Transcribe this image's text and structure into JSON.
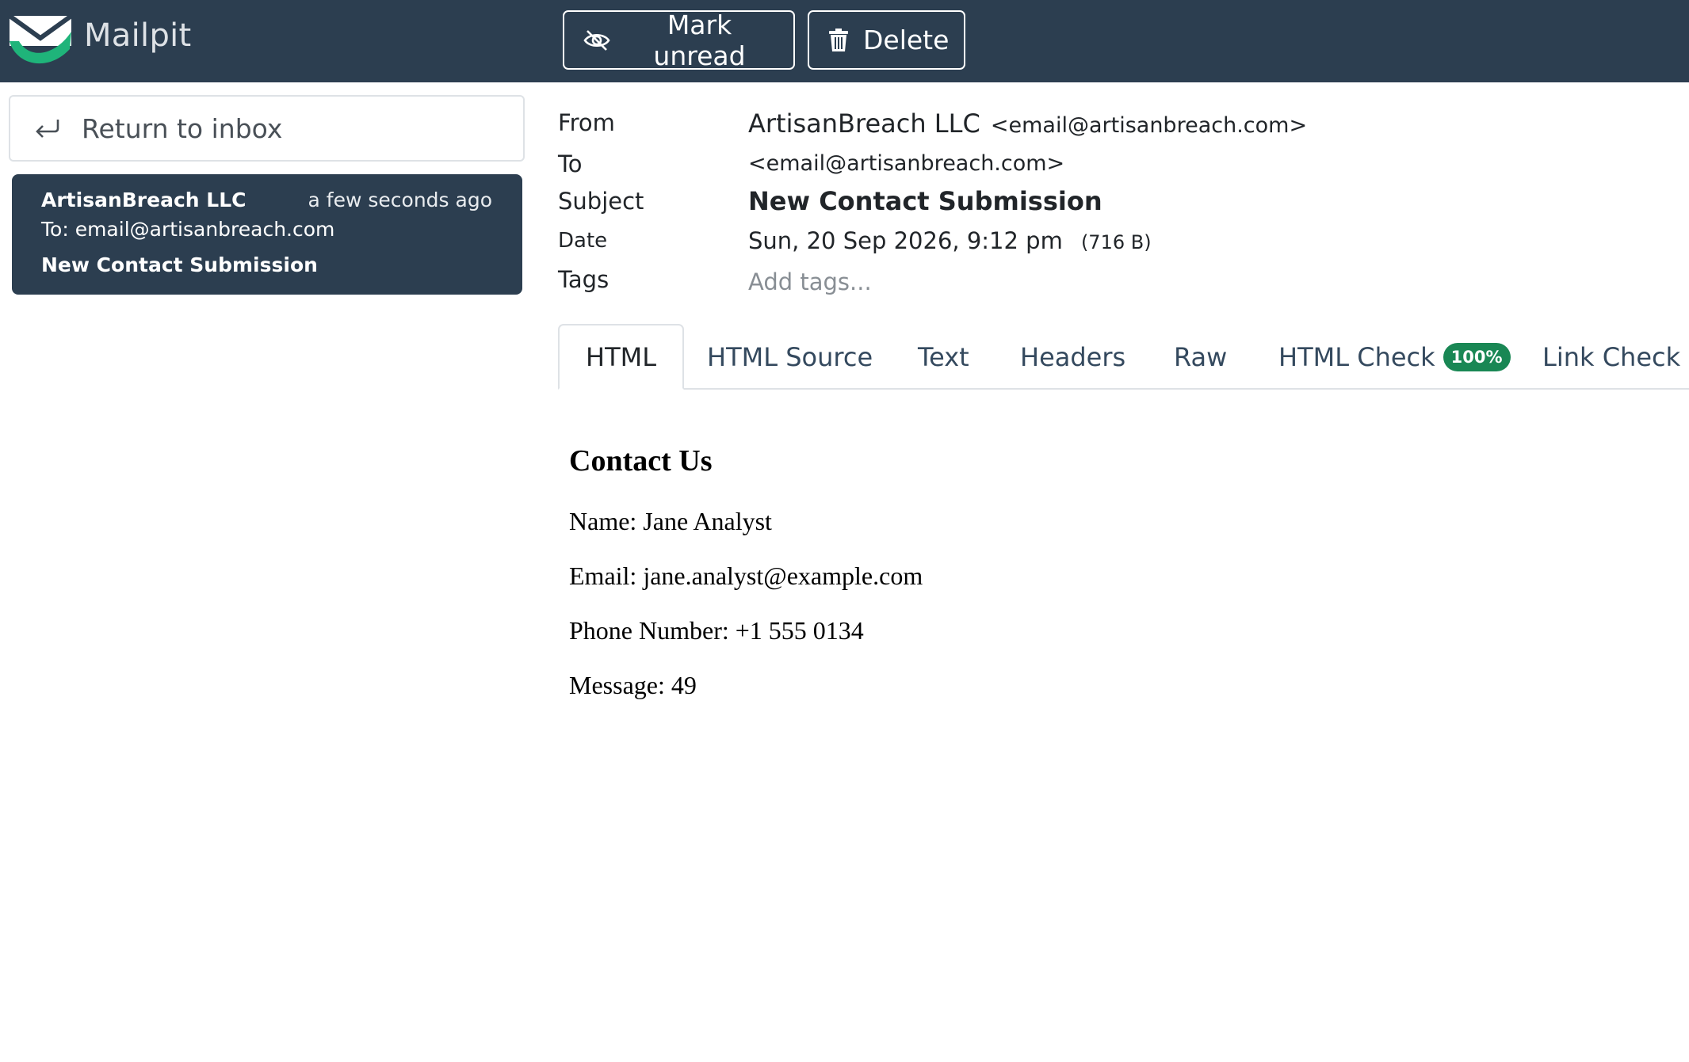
{
  "app": {
    "brand": "Mailpit"
  },
  "toolbar": {
    "mark_unread_label": "Mark unread",
    "delete_label": "Delete"
  },
  "sidebar": {
    "return_label": "Return to inbox",
    "message": {
      "from": "ArtisanBreach LLC",
      "time": "a few seconds ago",
      "to": "To: email@artisanbreach.com",
      "subject": "New Contact Submission"
    }
  },
  "headers": {
    "from_label": "From",
    "from_name": "ArtisanBreach LLC",
    "from_email": "<email@artisanbreach.com>",
    "to_label": "To",
    "to_value": "<email@artisanbreach.com>",
    "subject_label": "Subject",
    "subject_value": "New Contact Submission",
    "date_label": "Date",
    "date_value": "Sun, 20 Sep 2026, 9:12 pm",
    "size": "(716 B)",
    "tags_label": "Tags",
    "tags_placeholder": "Add tags..."
  },
  "tabs": [
    {
      "label": "HTML",
      "active": true
    },
    {
      "label": "HTML Source"
    },
    {
      "label": "Text"
    },
    {
      "label": "Headers"
    },
    {
      "label": "Raw"
    },
    {
      "label": "HTML Check",
      "badge": "100%"
    },
    {
      "label": "Link Check"
    }
  ],
  "body": {
    "title": "Contact Us",
    "name": "Name: Jane Analyst",
    "email": "Email: jane.analyst@example.com",
    "phone": "Phone Number: +1 555 0134",
    "message": "Message: 49"
  },
  "colors": {
    "navbar": "#2c3e50",
    "badge": "#198754",
    "logo_green": "#1fb47a"
  }
}
